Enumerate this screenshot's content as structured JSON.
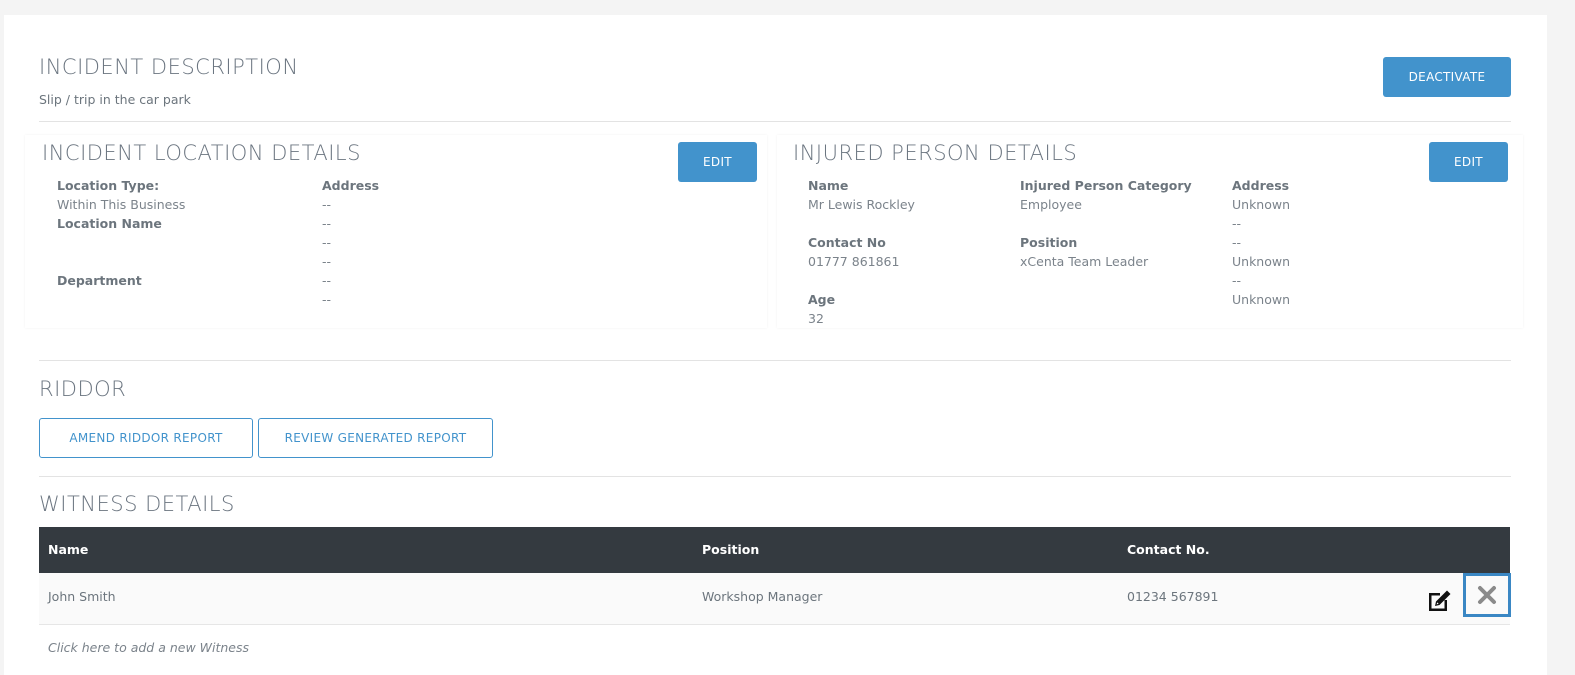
{
  "incident": {
    "title": "INCIDENT DESCRIPTION",
    "description": "Slip / trip in the car park",
    "deactivate_label": "DEACTIVATE"
  },
  "location": {
    "title": "INCIDENT LOCATION DETAILS",
    "edit_label": "EDIT",
    "location_type_label": "Location Type:",
    "location_type_value": "Within This Business",
    "location_name_label": "Location Name",
    "department_label": "Department",
    "address_label": "Address",
    "address_lines": [
      "--",
      "--",
      "--",
      "--",
      "--",
      "--"
    ]
  },
  "injured": {
    "title": "INJURED PERSON DETAILS",
    "edit_label": "EDIT",
    "name_label": "Name",
    "name_value": "Mr Lewis Rockley",
    "contact_label": "Contact No",
    "contact_value": "01777 861861",
    "age_label": "Age",
    "age_value": "32",
    "category_label": "Injured Person Category",
    "category_value": "Employee",
    "position_label": "Position",
    "position_value": "xCenta Team Leader",
    "address_label": "Address",
    "address_lines": [
      "Unknown",
      "--",
      "--",
      "Unknown",
      "--",
      "Unknown"
    ]
  },
  "riddor": {
    "title": "RIDDOR",
    "amend_label": "AMEND RIDDOR REPORT",
    "review_label": "REVIEW GENERATED REPORT"
  },
  "witness": {
    "title": "WITNESS DETAILS",
    "columns": [
      "Name",
      "Position",
      "Contact No."
    ],
    "rows": [
      {
        "name": "John Smith",
        "position": "Workshop Manager",
        "contact": "01234 567891"
      }
    ],
    "add_label": "Click here to add a new Witness"
  },
  "icons": {
    "edit": "edit-icon",
    "delete": "close-icon"
  },
  "colors": {
    "accent": "#4293cc",
    "table_header": "#343a40",
    "focus_border": "#3a87c4"
  }
}
